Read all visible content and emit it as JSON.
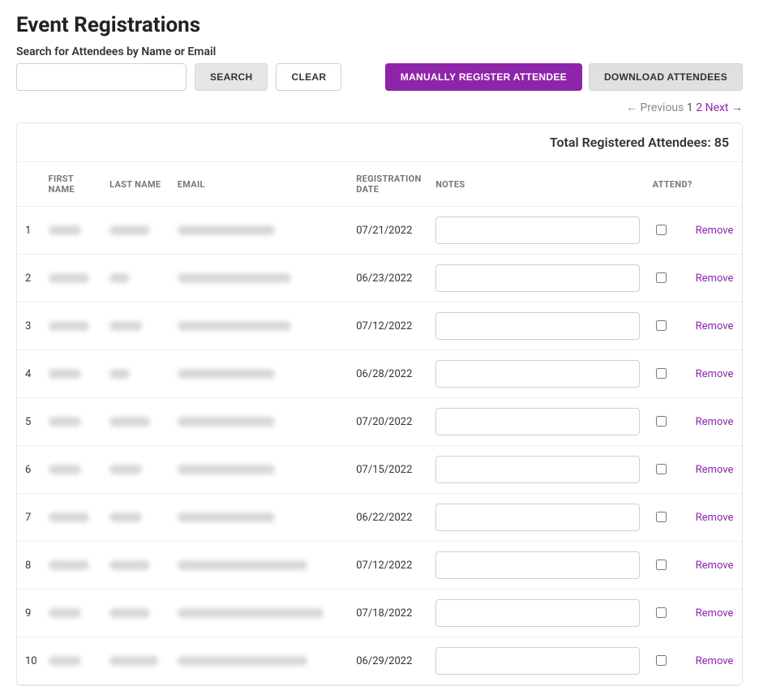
{
  "page": {
    "title": "Event Registrations",
    "search_label": "Search for Attendees by Name or Email"
  },
  "toolbar": {
    "search_value": "",
    "search_btn": "SEARCH",
    "clear_btn": "CLEAR",
    "manual_btn": "MANUALLY REGISTER ATTENDEE",
    "download_btn": "DOWNLOAD ATTENDEES"
  },
  "pagination": {
    "previous": "← Previous",
    "page_current": "1",
    "page_2": "2",
    "next": "Next →"
  },
  "summary": {
    "label": "Total Registered Attendees:",
    "count": "85"
  },
  "columns": {
    "num": "",
    "first_name": "FIRST NAME",
    "last_name": "LAST NAME",
    "email": "EMAIL",
    "reg_date": "REGISTRATION DATE",
    "notes": "NOTES",
    "attend": "ATTEND?",
    "remove": ""
  },
  "remove_label": "Remove",
  "rows": [
    {
      "num": "1",
      "date": "07/21/2022"
    },
    {
      "num": "2",
      "date": "06/23/2022"
    },
    {
      "num": "3",
      "date": "07/12/2022"
    },
    {
      "num": "4",
      "date": "06/28/2022"
    },
    {
      "num": "5",
      "date": "07/20/2022"
    },
    {
      "num": "6",
      "date": "07/15/2022"
    },
    {
      "num": "7",
      "date": "06/22/2022"
    },
    {
      "num": "8",
      "date": "07/12/2022"
    },
    {
      "num": "9",
      "date": "07/18/2022"
    },
    {
      "num": "10",
      "date": "06/29/2022"
    }
  ]
}
